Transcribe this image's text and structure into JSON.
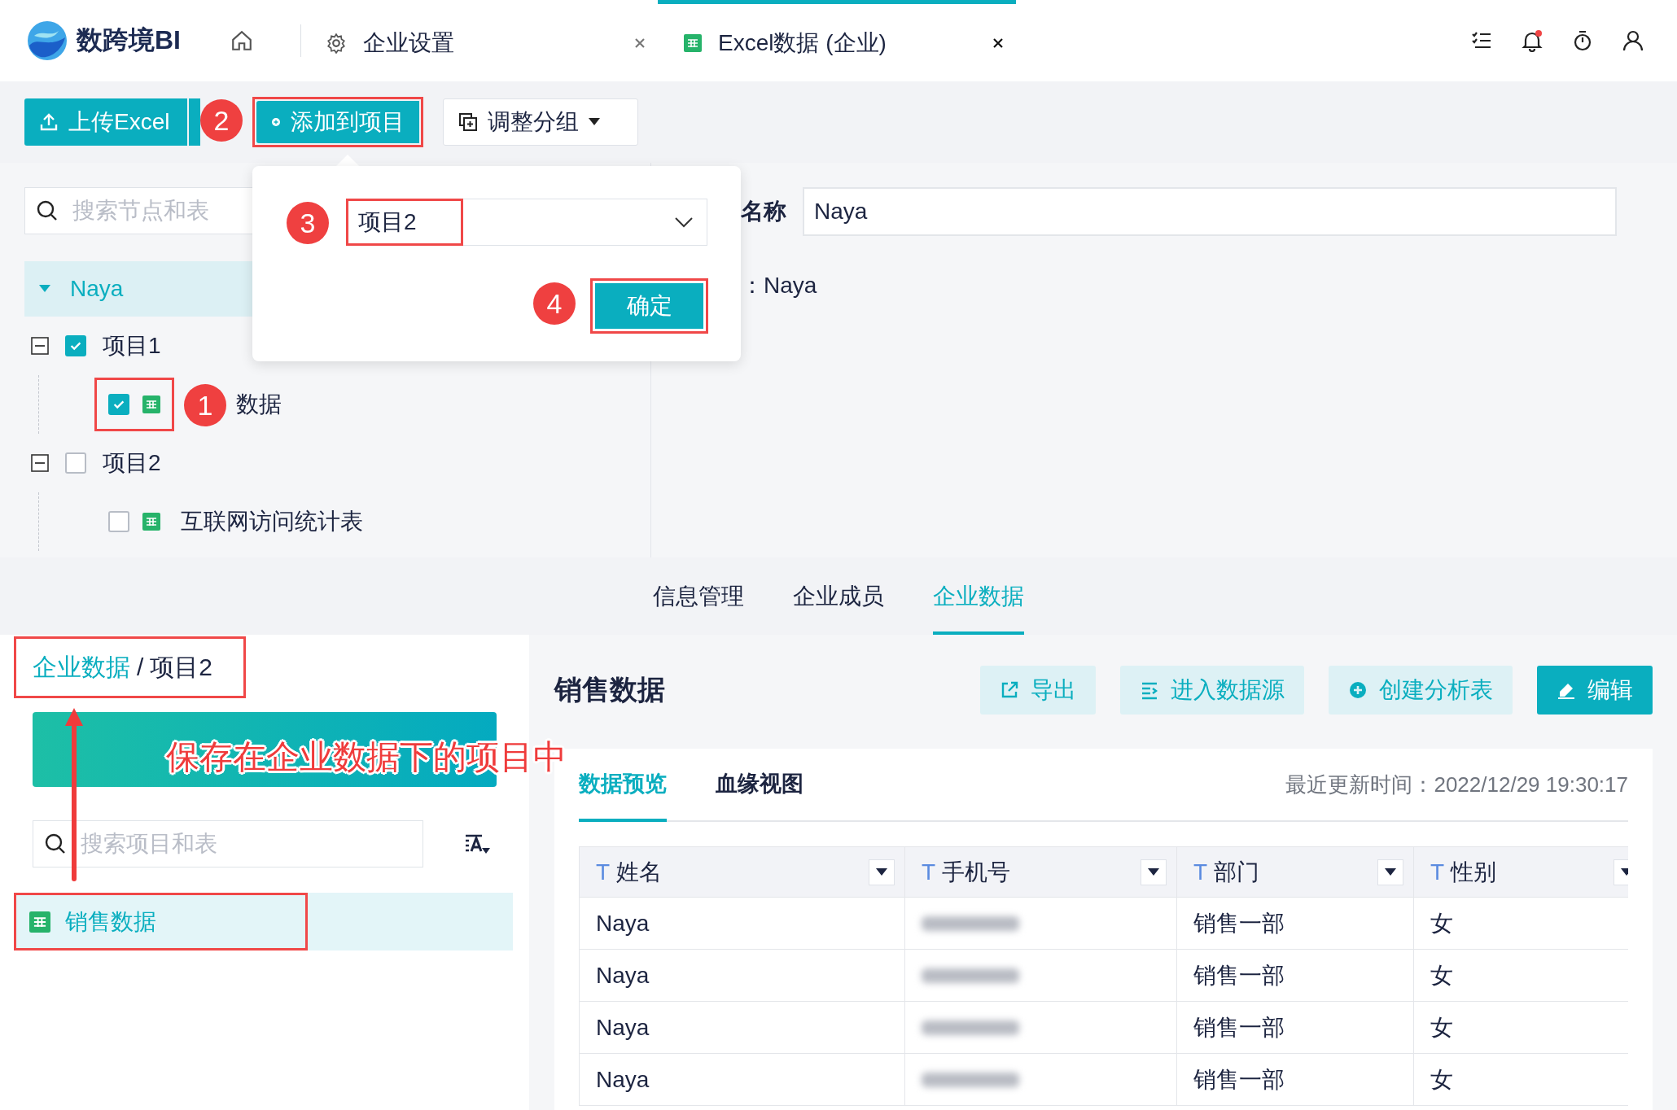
{
  "app": {
    "logo_text": "数跨境BI"
  },
  "tabs": [
    {
      "label": "企业设置",
      "selected": false
    },
    {
      "label": "Excel数据 (企业)",
      "selected": true
    }
  ],
  "toolbar": {
    "upload": "上传Excel",
    "add": {
      "label": "添加到项目",
      "highlighted": true
    },
    "group": "调整分组"
  },
  "tree": {
    "search_placeholder": "搜索节点和表",
    "root": {
      "label": "Naya",
      "expanded": true,
      "children": [
        {
          "label": "项目1",
          "checked": true,
          "expanded": true,
          "children": [
            {
              "label": "数据",
              "checked": true,
              "highlighted": true
            }
          ]
        },
        {
          "label": "项目2",
          "checked": false,
          "expanded": true,
          "children": [
            {
              "label": "互联网访问统计表",
              "checked": false,
              "highlighted": false
            }
          ]
        }
      ]
    }
  },
  "detail": {
    "name_label": "名称",
    "name_value": "Naya",
    "owner_text": "：Naya"
  },
  "popup": {
    "select_value": "项目2",
    "select_highlighted": true,
    "confirm": "确定",
    "confirm_highlighted": true
  },
  "section_tabs": [
    {
      "label": "信息管理",
      "selected": false
    },
    {
      "label": "企业成员",
      "selected": false
    },
    {
      "label": "企业数据",
      "selected": true
    }
  ],
  "breadcrumb": {
    "parent": "企业数据",
    "separator": "/",
    "current": "项目2",
    "highlighted": true
  },
  "project_search": {
    "placeholder": "搜索项目和表"
  },
  "project_items": [
    {
      "label": "销售数据",
      "selected": true,
      "highlighted": true
    }
  ],
  "dataset": {
    "title": "销售数据",
    "actions": [
      {
        "label": "导出",
        "kind": "light"
      },
      {
        "label": "进入数据源",
        "kind": "light"
      },
      {
        "label": "创建分析表",
        "kind": "light"
      },
      {
        "label": "编辑",
        "kind": "primary"
      }
    ],
    "view_tabs": [
      {
        "label": "数据预览",
        "selected": true
      },
      {
        "label": "血缘视图",
        "selected": false
      }
    ],
    "updated": "最近更新时间：2022/12/29 19:30:17"
  },
  "table": {
    "columns": [
      {
        "type_mark": "T",
        "label": "姓名"
      },
      {
        "type_mark": "T",
        "label": "手机号"
      },
      {
        "type_mark": "T",
        "label": "部门"
      },
      {
        "type_mark": "T",
        "label": "性别"
      }
    ],
    "rows": [
      {
        "name": "Naya",
        "department": "销售一部",
        "gender": "女"
      },
      {
        "name": "Naya",
        "department": "销售一部",
        "gender": "女"
      },
      {
        "name": "Naya",
        "department": "销售一部",
        "gender": "女"
      },
      {
        "name": "Naya",
        "department": "销售一部",
        "gender": "女"
      }
    ]
  },
  "annotations": {
    "caption": "保存在企业数据下的项目中",
    "steps": [
      "1",
      "2",
      "3",
      "4"
    ]
  }
}
